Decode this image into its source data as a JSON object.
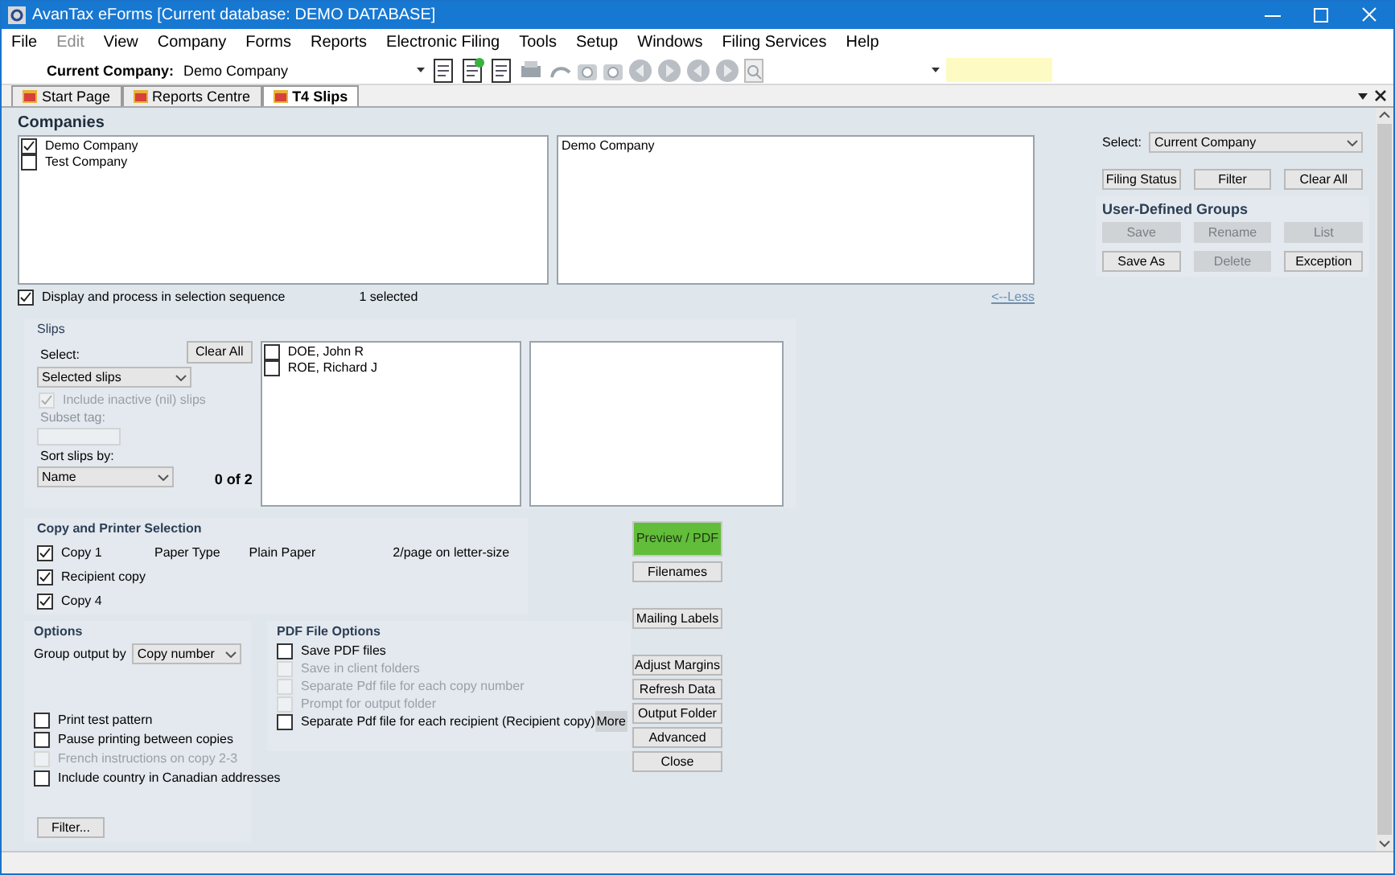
{
  "window": {
    "title": "AvanTax eForms [Current database: DEMO DATABASE]"
  },
  "menu": [
    {
      "label": "File",
      "disabled": false
    },
    {
      "label": "Edit",
      "disabled": true
    },
    {
      "label": "View",
      "disabled": false
    },
    {
      "label": "Company",
      "disabled": false
    },
    {
      "label": "Forms",
      "disabled": false
    },
    {
      "label": "Reports",
      "disabled": false
    },
    {
      "label": "Electronic Filing",
      "disabled": false
    },
    {
      "label": "Tools",
      "disabled": false
    },
    {
      "label": "Setup",
      "disabled": false
    },
    {
      "label": "Windows",
      "disabled": false
    },
    {
      "label": "Filing Services",
      "disabled": false
    },
    {
      "label": "Help",
      "disabled": false
    }
  ],
  "toolbar": {
    "company_label": "Current Company:",
    "company_value": "Demo Company"
  },
  "tabs": [
    {
      "label": "Start Page",
      "selected": false
    },
    {
      "label": "Reports Centre",
      "selected": false
    },
    {
      "label": "T4 Slips",
      "selected": true
    }
  ],
  "companies": {
    "heading": "Companies",
    "items": [
      {
        "label": "Demo Company",
        "checked": true
      },
      {
        "label": "Test Company",
        "checked": false
      }
    ],
    "selected_items": [
      "Demo Company"
    ],
    "sequence": {
      "label": "Display and process in selection sequence",
      "checked": true
    },
    "count": "1 selected",
    "less_link": "<--Less"
  },
  "selection": {
    "select_label": "Select:",
    "select_value": "Current Company",
    "buttons": [
      {
        "label": "Filing Status",
        "disabled": false
      },
      {
        "label": "Filter",
        "disabled": false
      },
      {
        "label": "Clear All",
        "disabled": false
      }
    ],
    "groups_heading": "User-Defined Groups",
    "group_buttons": [
      {
        "label": "Save",
        "disabled": true
      },
      {
        "label": "Rename",
        "disabled": true
      },
      {
        "label": "List",
        "disabled": true
      },
      {
        "label": "Save As",
        "disabled": false
      },
      {
        "label": "Delete",
        "disabled": true
      },
      {
        "label": "Exception",
        "disabled": false
      }
    ]
  },
  "slips": {
    "heading": "Slips",
    "select_label": "Select:",
    "clear_all": "Clear All",
    "select_value": "Selected slips",
    "include_inactive": {
      "label": "Include inactive (nil) slips",
      "checked": true,
      "disabled": true
    },
    "subset_label": "Subset tag:",
    "sort_label": "Sort slips by:",
    "sort_value": "Name",
    "count": "0 of 2",
    "items": [
      {
        "label": "DOE, John R",
        "checked": false
      },
      {
        "label": "ROE, Richard J",
        "checked": false
      }
    ]
  },
  "copy": {
    "heading": "Copy and Printer Selection",
    "copies": [
      {
        "label": "Copy 1",
        "checked": true
      },
      {
        "label": "Recipient copy",
        "checked": true
      },
      {
        "label": "Copy 4",
        "checked": true
      }
    ],
    "paper_type_label": "Paper Type",
    "paper_type_value": "Plain Paper",
    "layout": "2/page on letter-size"
  },
  "options": {
    "heading": "Options",
    "group_label": "Group output by",
    "group_value": "Copy number",
    "checks": [
      {
        "label": "Print test pattern",
        "checked": false,
        "disabled": false
      },
      {
        "label": "Pause printing between copies",
        "checked": false,
        "disabled": false
      },
      {
        "label": "French instructions on copy 2-3",
        "checked": false,
        "disabled": true
      },
      {
        "label": "Include country in Canadian addresses",
        "checked": false,
        "disabled": false
      }
    ],
    "filter_button": "Filter..."
  },
  "pdf": {
    "heading": "PDF File Options",
    "checks": [
      {
        "label": "Save PDF files",
        "checked": false,
        "disabled": false
      },
      {
        "label": "Save in client folders",
        "checked": false,
        "disabled": true
      },
      {
        "label": "Separate Pdf file for each copy number",
        "checked": false,
        "disabled": true
      },
      {
        "label": "Prompt for output folder",
        "checked": false,
        "disabled": true
      },
      {
        "label": "Separate Pdf file for each recipient (Recipient copy)",
        "checked": false,
        "disabled": false
      }
    ],
    "more_button": "More"
  },
  "actions": [
    {
      "buttons": [
        {
          "label": "Preview / PDF",
          "kind": "primary"
        },
        {
          "label": "Filenames",
          "kind": "normal"
        }
      ]
    },
    {
      "buttons": [
        {
          "label": "Mailing Labels",
          "kind": "normal"
        }
      ]
    },
    {
      "buttons": [
        {
          "label": "Adjust Margins",
          "kind": "normal"
        },
        {
          "label": "Refresh Data",
          "kind": "normal"
        },
        {
          "label": "Output Folder",
          "kind": "normal"
        },
        {
          "label": "Advanced",
          "kind": "normal"
        },
        {
          "label": "Close",
          "kind": "normal"
        }
      ]
    }
  ]
}
